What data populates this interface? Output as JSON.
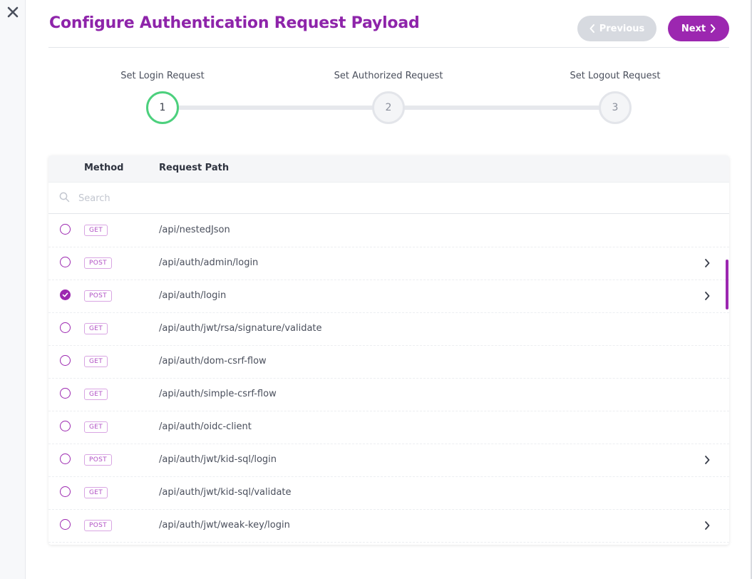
{
  "header": {
    "title": "Configure Authentication Request Payload",
    "previous_label": "Previous",
    "next_label": "Next"
  },
  "steps": [
    {
      "label": "Set Login Request",
      "number": "1",
      "active": true
    },
    {
      "label": "Set Authorized Request",
      "number": "2",
      "active": false
    },
    {
      "label": "Set Logout Request",
      "number": "3",
      "active": false
    }
  ],
  "table": {
    "columns": {
      "method": "Method",
      "path": "Request Path"
    },
    "search_placeholder": "Search",
    "rows": [
      {
        "method": "GET",
        "path": "/api/nestedJson",
        "selected": false,
        "expandable": false
      },
      {
        "method": "POST",
        "path": "/api/auth/admin/login",
        "selected": false,
        "expandable": true
      },
      {
        "method": "POST",
        "path": "/api/auth/login",
        "selected": true,
        "expandable": true
      },
      {
        "method": "GET",
        "path": "/api/auth/jwt/rsa/signature/validate",
        "selected": false,
        "expandable": false
      },
      {
        "method": "GET",
        "path": "/api/auth/dom-csrf-flow",
        "selected": false,
        "expandable": false
      },
      {
        "method": "GET",
        "path": "/api/auth/simple-csrf-flow",
        "selected": false,
        "expandable": false
      },
      {
        "method": "GET",
        "path": "/api/auth/oidc-client",
        "selected": false,
        "expandable": false
      },
      {
        "method": "POST",
        "path": "/api/auth/jwt/kid-sql/login",
        "selected": false,
        "expandable": true
      },
      {
        "method": "GET",
        "path": "/api/auth/jwt/kid-sql/validate",
        "selected": false,
        "expandable": false
      },
      {
        "method": "POST",
        "path": "/api/auth/jwt/weak-key/login",
        "selected": false,
        "expandable": true
      }
    ]
  },
  "colors": {
    "accent": "#9c27b0",
    "title": "#8e24aa",
    "step_active": "#4cd07d",
    "button_disabled": "#d7dae0"
  },
  "icons": {
    "close": "close-icon",
    "search": "search-icon",
    "chevron_left": "chevron-left-icon",
    "chevron_right": "chevron-right-icon",
    "check": "check-icon"
  }
}
